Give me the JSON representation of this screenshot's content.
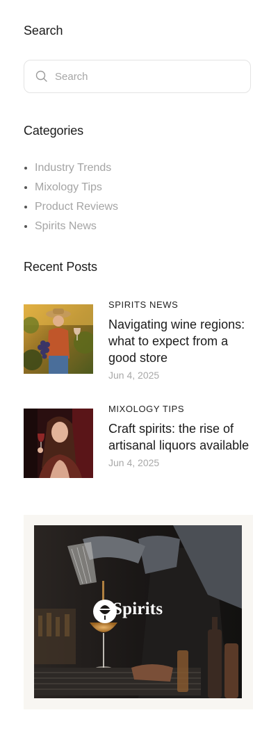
{
  "search": {
    "title": "Search",
    "placeholder": "Search"
  },
  "categories": {
    "title": "Categories",
    "items": [
      {
        "label": "Industry Trends"
      },
      {
        "label": "Mixology Tips"
      },
      {
        "label": "Product Reviews"
      },
      {
        "label": "Spirits News"
      }
    ]
  },
  "recent_posts": {
    "title": "Recent Posts",
    "posts": [
      {
        "category": "SPIRITS NEWS",
        "title": "Navigating wine regions: what to expect from a good store",
        "date": "Jun 4, 2025"
      },
      {
        "category": "MIXOLOGY TIPS",
        "title": "Craft spirits: the rise of artisanal liquors available",
        "date": "Jun 4, 2025"
      }
    ]
  },
  "promo": {
    "brand": "Spirits"
  },
  "colors": {
    "text": "#1a1a1a",
    "muted": "#a4a4a4",
    "border": "#e3e3e3",
    "promo_bg": "#f8f6f2"
  }
}
